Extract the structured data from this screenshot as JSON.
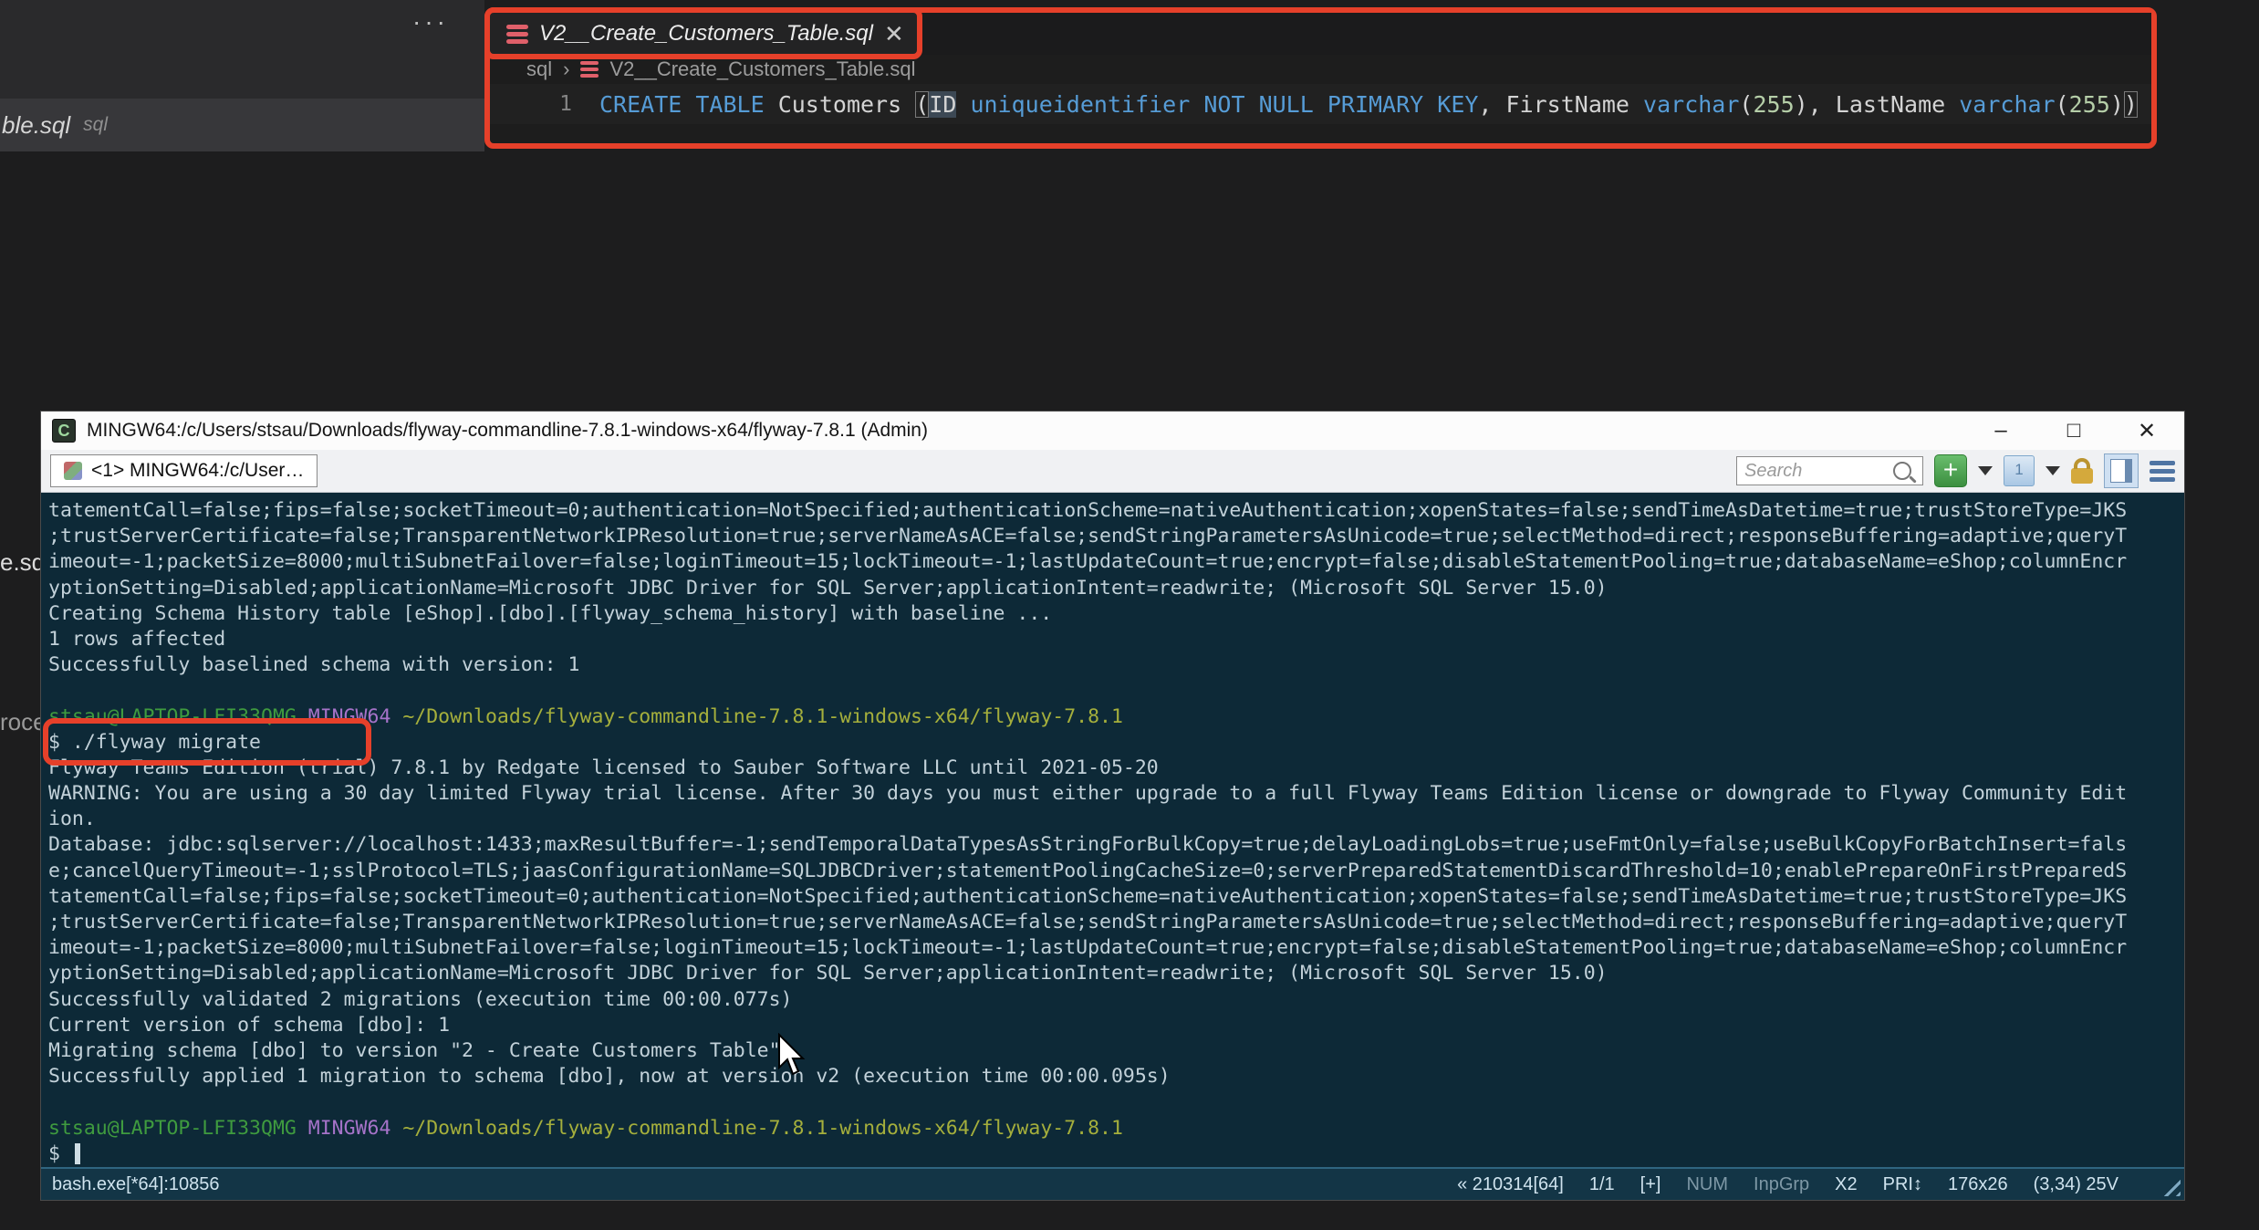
{
  "background": {
    "editor_actions_ellipsis": "···",
    "tab_fragment_label": "ble.sql",
    "tab_fragment_ext": "sql",
    "left_fragment_top": "e.sq",
    "left_fragment_bottom": "roce"
  },
  "editor": {
    "tab": {
      "label": "V2__Create_Customers_Table.sql",
      "close": "✕"
    },
    "breadcrumb": {
      "root": "sql",
      "separator": "›",
      "file": "V2__Create_Customers_Table.sql"
    },
    "line_number": "1",
    "code_tokens": [
      {
        "t": "CREATE",
        "c": "kw"
      },
      {
        "t": " ",
        "c": "id"
      },
      {
        "t": "TABLE",
        "c": "kw"
      },
      {
        "t": " Customers ",
        "c": "id"
      },
      {
        "t": "(",
        "c": "brk"
      },
      {
        "t": "ID",
        "c": "idhl"
      },
      {
        "t": " ",
        "c": "id"
      },
      {
        "t": "uniqueidentifier",
        "c": "kw"
      },
      {
        "t": " ",
        "c": "id"
      },
      {
        "t": "NOT",
        "c": "kw"
      },
      {
        "t": " ",
        "c": "id"
      },
      {
        "t": "NULL",
        "c": "kw"
      },
      {
        "t": " ",
        "c": "id"
      },
      {
        "t": "PRIMARY",
        "c": "kw"
      },
      {
        "t": " ",
        "c": "id"
      },
      {
        "t": "KEY",
        "c": "kw"
      },
      {
        "t": ", FirstName ",
        "c": "id"
      },
      {
        "t": "varchar",
        "c": "kw"
      },
      {
        "t": "(",
        "c": "id"
      },
      {
        "t": "255",
        "c": "num"
      },
      {
        "t": "), LastName ",
        "c": "id"
      },
      {
        "t": "varchar",
        "c": "kw"
      },
      {
        "t": "(",
        "c": "id"
      },
      {
        "t": "255",
        "c": "num"
      },
      {
        "t": ")",
        "c": "id"
      },
      {
        "t": ")",
        "c": "brk"
      }
    ],
    "annotation_color": "#e6402a"
  },
  "terminal": {
    "title": "MINGW64:/c/Users/stsau/Downloads/flyway-commandline-7.8.1-windows-x64/flyway-7.8.1 (Admin)",
    "icon_letter": "C",
    "window_controls": {
      "minimize": "–",
      "maximize": "□",
      "close": "✕"
    },
    "tab_label": "<1> MINGW64:/c/User…",
    "search_placeholder": "Search",
    "toolbar_buttons": {
      "new_console": "+",
      "switch_window": "1"
    },
    "colors": {
      "bg": "#0d2937",
      "text": "#c2d1d9",
      "prompt_user": "#3f9b3f",
      "prompt_host_tag": "#a673c9",
      "prompt_path": "#a5af3c",
      "statusbar_bg": "#133546",
      "annotation": "#e6402a"
    },
    "lines": [
      {
        "segments": [
          {
            "t": "tatementCall=false;fips=false;socketTimeout=0;authentication=NotSpecified;authenticationScheme=nativeAuthentication;xopenStates=false;sendTimeAsDatetime=true;trustStoreType=JKS"
          }
        ]
      },
      {
        "segments": [
          {
            "t": ";trustServerCertificate=false;TransparentNetworkIPResolution=true;serverNameAsACE=false;sendStringParametersAsUnicode=true;selectMethod=direct;responseBuffering=adaptive;queryT"
          }
        ]
      },
      {
        "segments": [
          {
            "t": "imeout=-1;packetSize=8000;multiSubnetFailover=false;loginTimeout=15;lockTimeout=-1;lastUpdateCount=true;encrypt=false;disableStatementPooling=true;databaseName=eShop;columnEncr"
          }
        ]
      },
      {
        "segments": [
          {
            "t": "yptionSetting=Disabled;applicationName=Microsoft JDBC Driver for SQL Server;applicationIntent=readwrite; (Microsoft SQL Server 15.0)"
          }
        ]
      },
      {
        "segments": [
          {
            "t": "Creating Schema History table [eShop].[dbo].[flyway_schema_history] with baseline ..."
          }
        ]
      },
      {
        "segments": [
          {
            "t": "1 rows affected"
          }
        ]
      },
      {
        "segments": [
          {
            "t": "Successfully baselined schema with version: 1"
          }
        ]
      },
      {
        "segments": [
          {
            "t": ""
          }
        ]
      },
      {
        "segments": [
          {
            "t": "stsau@LAPTOP-LFI33QMG",
            "c": "green"
          },
          {
            "t": " "
          },
          {
            "t": "MINGW64",
            "c": "purple"
          },
          {
            "t": " "
          },
          {
            "t": "~/Downloads/flyway-commandline-7.8.1-windows-x64/flyway-7.8.1",
            "c": "yellow"
          }
        ]
      },
      {
        "segments": [
          {
            "t": "$ ./flyway migrate"
          }
        ]
      },
      {
        "segments": [
          {
            "t": "Flyway Teams Edition (trial) 7.8.1 by Redgate licensed to Sauber Software LLC until 2021-05-20"
          }
        ]
      },
      {
        "segments": [
          {
            "t": "WARNING: You are using a 30 day limited Flyway trial license. After 30 days you must either upgrade to a full Flyway Teams Edition license or downgrade to Flyway Community Edit"
          }
        ]
      },
      {
        "segments": [
          {
            "t": "ion."
          }
        ]
      },
      {
        "segments": [
          {
            "t": "Database: jdbc:sqlserver://localhost:1433;maxResultBuffer=-1;sendTemporalDataTypesAsStringForBulkCopy=true;delayLoadingLobs=true;useFmtOnly=false;useBulkCopyForBatchInsert=fals"
          }
        ]
      },
      {
        "segments": [
          {
            "t": "e;cancelQueryTimeout=-1;sslProtocol=TLS;jaasConfigurationName=SQLJDBCDriver;statementPoolingCacheSize=0;serverPreparedStatementDiscardThreshold=10;enablePrepareOnFirstPreparedS"
          }
        ]
      },
      {
        "segments": [
          {
            "t": "tatementCall=false;fips=false;socketTimeout=0;authentication=NotSpecified;authenticationScheme=nativeAuthentication;xopenStates=false;sendTimeAsDatetime=true;trustStoreType=JKS"
          }
        ]
      },
      {
        "segments": [
          {
            "t": ";trustServerCertificate=false;TransparentNetworkIPResolution=true;serverNameAsACE=false;sendStringParametersAsUnicode=true;selectMethod=direct;responseBuffering=adaptive;queryT"
          }
        ]
      },
      {
        "segments": [
          {
            "t": "imeout=-1;packetSize=8000;multiSubnetFailover=false;loginTimeout=15;lockTimeout=-1;lastUpdateCount=true;encrypt=false;disableStatementPooling=true;databaseName=eShop;columnEncr"
          }
        ]
      },
      {
        "segments": [
          {
            "t": "yptionSetting=Disabled;applicationName=Microsoft JDBC Driver for SQL Server;applicationIntent=readwrite; (Microsoft SQL Server 15.0)"
          }
        ]
      },
      {
        "segments": [
          {
            "t": "Successfully validated 2 migrations (execution time 00:00.077s)"
          }
        ]
      },
      {
        "segments": [
          {
            "t": "Current version of schema [dbo]: 1"
          }
        ]
      },
      {
        "segments": [
          {
            "t": "Migrating schema [dbo] to version \"2 - Create Customers Table\""
          }
        ]
      },
      {
        "segments": [
          {
            "t": "Successfully applied 1 migration to schema [dbo], now at version v2 (execution time 00:00.095s)"
          }
        ]
      },
      {
        "segments": [
          {
            "t": ""
          }
        ]
      },
      {
        "segments": [
          {
            "t": "stsau@LAPTOP-LFI33QMG",
            "c": "green"
          },
          {
            "t": " "
          },
          {
            "t": "MINGW64",
            "c": "purple"
          },
          {
            "t": " "
          },
          {
            "t": "~/Downloads/flyway-commandline-7.8.1-windows-x64/flyway-7.8.1",
            "c": "yellow"
          }
        ]
      },
      {
        "segments": [
          {
            "t": "$ "
          }
        ],
        "cursor": true
      }
    ],
    "status": {
      "left": "bash.exe[*64]:10856",
      "items": [
        {
          "t": "« 210314[64]"
        },
        {
          "t": "1/1"
        },
        {
          "t": "[+]"
        },
        {
          "t": "NUM",
          "dim": true
        },
        {
          "t": "InpGrp",
          "dim": true
        },
        {
          "t": "X2"
        },
        {
          "t": "PRI↕"
        },
        {
          "t": "176x26"
        },
        {
          "t": "(3,34) 25V"
        }
      ]
    }
  }
}
